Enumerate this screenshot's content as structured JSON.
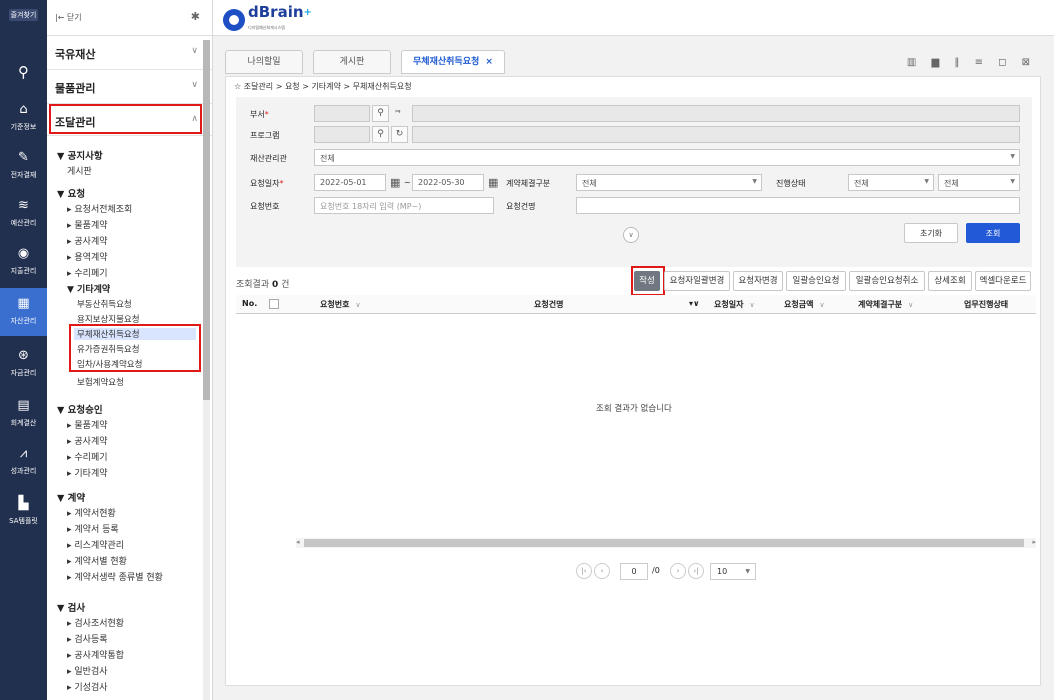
{
  "iconbar": {
    "top_label": "즐겨찾기",
    "items": [
      {
        "label": "기준정보",
        "icon": "home-icon"
      },
      {
        "label": "전자결재",
        "icon": "pen-icon"
      },
      {
        "label": "예산관리",
        "icon": "coins-icon"
      },
      {
        "label": "지출관리",
        "icon": "wallet-icon"
      },
      {
        "label": "자산관리",
        "icon": "building-icon"
      },
      {
        "label": "자금관리",
        "icon": "money-icon"
      },
      {
        "label": "회계결산",
        "icon": "ledger-icon"
      },
      {
        "label": "성과관리",
        "icon": "chart-icon"
      },
      {
        "label": "SA템플릿",
        "icon": "template-icon"
      }
    ],
    "active_index": 4
  },
  "menu": {
    "close_label": "|← 닫기",
    "groups": [
      "국유재산",
      "물품관리",
      "조달관리"
    ],
    "sections": {
      "notice": {
        "title": "▼ 공지사항",
        "items": [
          "게시판"
        ]
      },
      "request": {
        "title": "▼ 요청",
        "items": [
          "▸ 요청서전체조회",
          "▸ 물품계약",
          "▸ 공사계약",
          "▸ 용역계약",
          "▸ 수리폐기"
        ],
        "other": {
          "title": "▼ 기타계약",
          "items": [
            "부동산취득요청",
            "용지보상지불요청",
            "무체재산취득요청",
            "유가증권취득요청",
            "임차/사용계약요청",
            "보험계약요청"
          ]
        }
      },
      "approval": {
        "title": "▼ 요청승인",
        "items": [
          "▸ 물품계약",
          "▸ 공사계약",
          "▸ 수리폐기",
          "▸ 기타계약"
        ]
      },
      "contract": {
        "title": "▼ 계약",
        "items": [
          "▸ 계약서현황",
          "▸ 계약서 등록",
          "▸ 리스계약관리",
          "▸ 계약서별 현황",
          "▸ 계약서생략 종류별 현황"
        ]
      },
      "inspection": {
        "title": "▼ 검사",
        "items": [
          "▸ 검사조서현황",
          "▸ 검사등록",
          "▸ 공사계약통합",
          "▸ 일반검사",
          "▸ 기성검사"
        ]
      }
    }
  },
  "app": {
    "logo": "dBrain",
    "logo_plus": "+",
    "logo_sub": "디지털예산회계시스템"
  },
  "tabs": [
    {
      "label": "나의할일"
    },
    {
      "label": "게시판"
    },
    {
      "label": "무체재산취득요청",
      "close": "×"
    }
  ],
  "view_icons": "▥ ▆ ‖ ≡ ◻ ⊠",
  "breadcrumb": "☆ 조달관리 > 요청 > 기타계약 > 무체재산취득요청",
  "form": {
    "dept_label": "부서",
    "req_mark": "*",
    "dept_extra": "ᄏ",
    "program_label": "프로그램",
    "asset_org_label": "재산관리관",
    "asset_org_value": "전체",
    "req_date_label": "요청일자",
    "date_from": "2022-05-01",
    "date_to": "2022-05-30",
    "date_sep": "~",
    "contract_type_label": "계약체결구분",
    "contract_type_value": "전체",
    "status_label": "진행상태",
    "status_value1": "전체",
    "status_value2": "전체",
    "req_no_label": "요청번호",
    "req_no_placeholder": "요청번호 18자리 입력 (MP~)",
    "req_name_label": "요청건명",
    "reset_label": "초기화",
    "search_label": "조회"
  },
  "results": {
    "count_prefix": "조회결과",
    "count": "0",
    "count_suffix": "건",
    "actions": [
      "작성",
      "요청자일괄변경",
      "요청자변경",
      "일괄승인요청",
      "일괄승인요청취소",
      "상세조회",
      "엑셀다운로드"
    ],
    "columns": [
      "No.",
      "요청번호",
      "요청건명",
      "요청일자",
      "요청금액",
      "계약체결구분",
      "업무진행상태"
    ],
    "empty_message": "조회 결과가 없습니다"
  },
  "pager": {
    "page": "0",
    "total": "/0",
    "page_size": "10"
  },
  "colors": {
    "highlight": "#e01818",
    "primary": "#2259d6",
    "sidebar_bg": "#22304f"
  }
}
